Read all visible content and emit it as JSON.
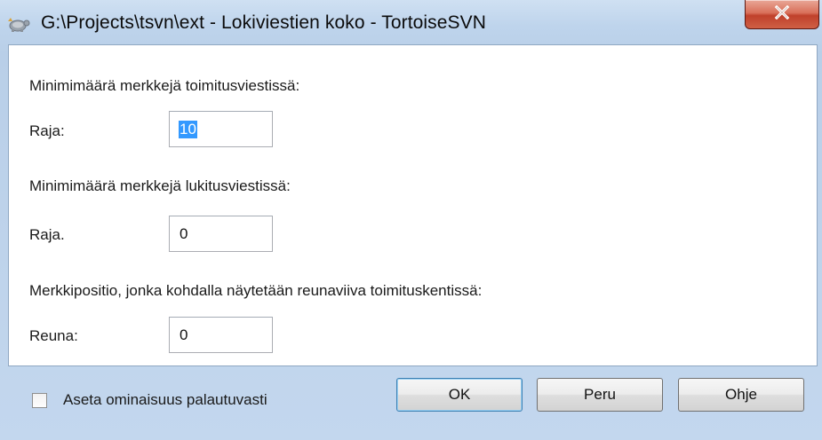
{
  "window": {
    "title": "G:\\Projects\\tsvn\\ext - Lokiviestien koko - TortoiseSVN",
    "app_icon": "tortoise-icon",
    "close_icon": "close-icon"
  },
  "sections": [
    {
      "heading": "Minimimäärä merkkejä toimitusviestissä:",
      "label": "Raja:",
      "value": "10",
      "selected": true
    },
    {
      "heading": "Minimimäärä merkkejä lukitusviestissä:",
      "label": "Raja.",
      "value": "0",
      "selected": false
    },
    {
      "heading": "Merkkipositio, jonka kohdalla näytetään reunaviiva toimituskentissä:",
      "label": "Reuna:",
      "value": "0",
      "selected": false
    }
  ],
  "footer": {
    "checkbox_label": "Aseta ominaisuus palautuvasti",
    "checkbox_checked": false,
    "ok_label": "OK",
    "cancel_label": "Peru",
    "help_label": "Ohje"
  }
}
